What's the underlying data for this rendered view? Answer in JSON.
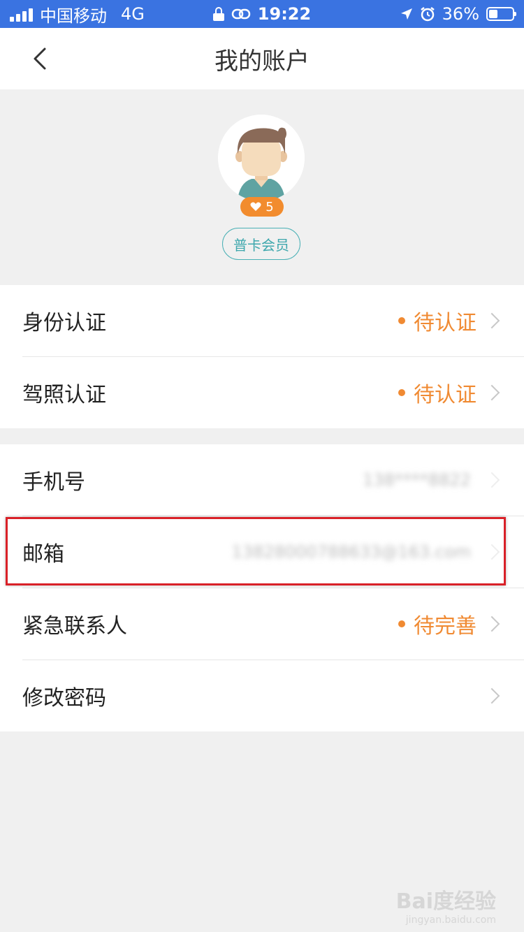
{
  "status_bar": {
    "carrier": "中国移动",
    "network": "4G",
    "time": "19:22",
    "battery": "36%",
    "battery_level": 0.36
  },
  "nav": {
    "title": "我的账户"
  },
  "profile": {
    "likes": "5",
    "member_level": "普卡会员"
  },
  "section1": [
    {
      "label": "身份认证",
      "status": "待认证"
    },
    {
      "label": "驾照认证",
      "status": "待认证"
    }
  ],
  "section2": [
    {
      "label": "手机号",
      "value": "138****8822"
    },
    {
      "label": "邮箱",
      "value": "13828000788633@163.com"
    },
    {
      "label": "紧急联系人",
      "status": "待完善"
    },
    {
      "label": "修改密码"
    }
  ],
  "watermark": {
    "brand": "Bai度经验",
    "url": "jingyan.baidu.com"
  },
  "colors": {
    "status_bar": "#3a73e1",
    "accent_orange": "#f08a32",
    "teal": "#4ab0b5",
    "highlight": "#d92128"
  }
}
